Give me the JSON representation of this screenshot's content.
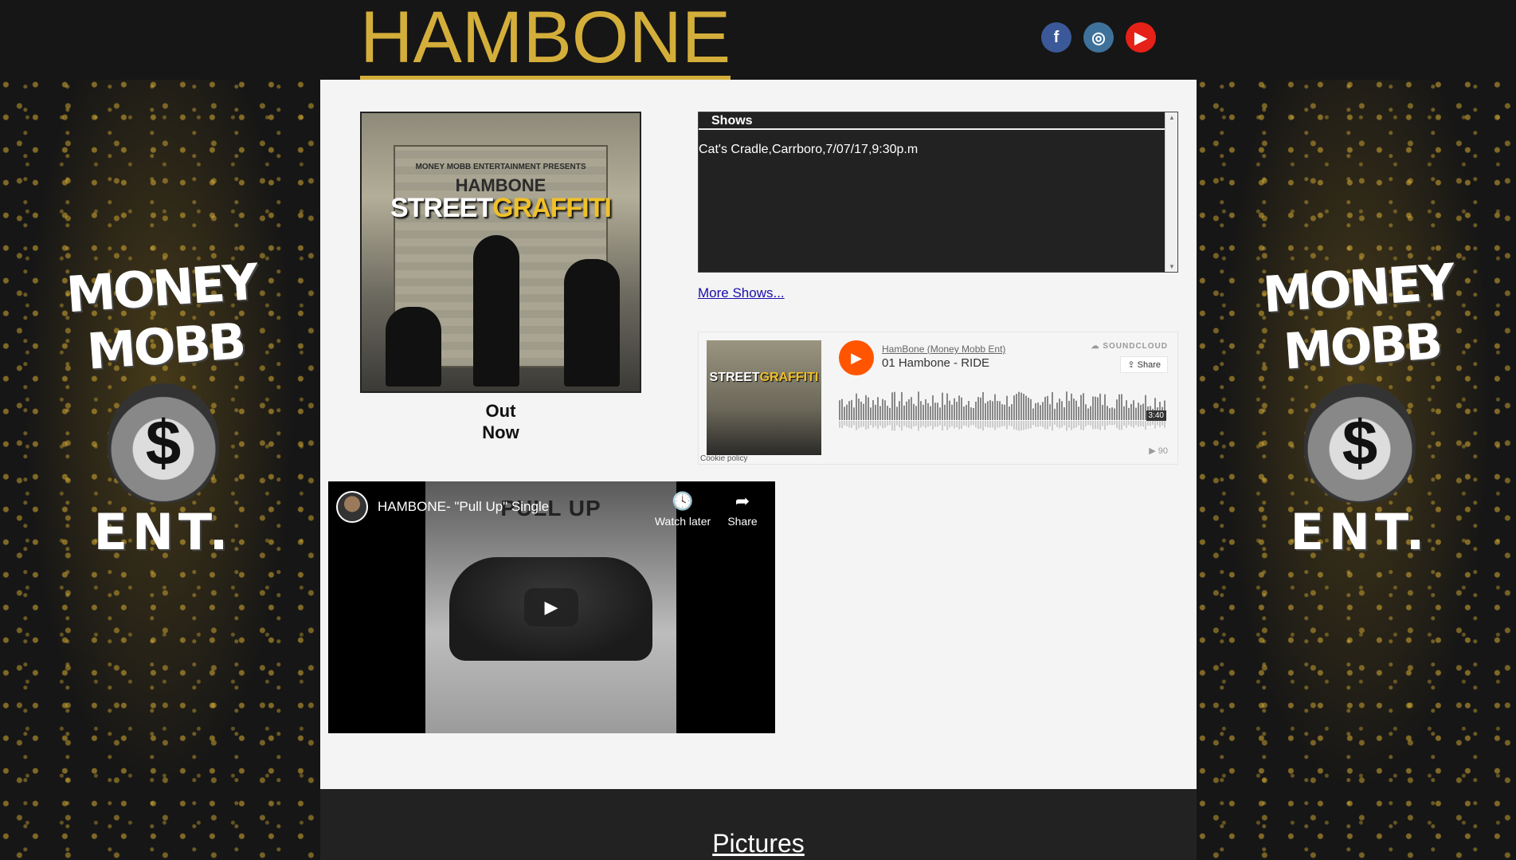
{
  "header": {
    "title": "HAMBONE",
    "social": [
      {
        "name": "facebook-icon",
        "glyph": "f",
        "color": "#3b5998"
      },
      {
        "name": "instagram-icon",
        "glyph": "◎",
        "color": "#3f729b"
      },
      {
        "name": "youtube-icon",
        "glyph": "▶",
        "color": "#e62117"
      }
    ]
  },
  "side_logo": {
    "line1": "MONEY MOBB",
    "symbol": "$",
    "line2": "ENT."
  },
  "album": {
    "presents": "MONEY MOBB ENTERTAINMENT PRESENTS",
    "artist": "HAMBONE",
    "name_part1": "STREET",
    "name_part2": "GRAFFITI",
    "caption_line1": "Out",
    "caption_line2": "Now"
  },
  "shows": {
    "heading": "Shows",
    "items": [
      "Cat's Cradle,Carrboro,7/07/17,9:30p.m"
    ],
    "more_link": "More Shows..."
  },
  "soundcloud": {
    "user": "HamBone (Money Mobb Ent)",
    "track": "01 Hambone - RIDE",
    "brand": "SOUNDCLOUD",
    "share_label": "Share",
    "duration": "3:40",
    "plays": "90",
    "cookie": "Cookie policy",
    "art_title_part1": "STREET",
    "art_title_part2": "GRAFFITI"
  },
  "youtube": {
    "title": "HAMBONE- \"Pull Up\" Single",
    "watch_later": "Watch later",
    "share": "Share",
    "thumb_title": "PULL UP"
  },
  "pictures": {
    "heading": "Pictures"
  }
}
